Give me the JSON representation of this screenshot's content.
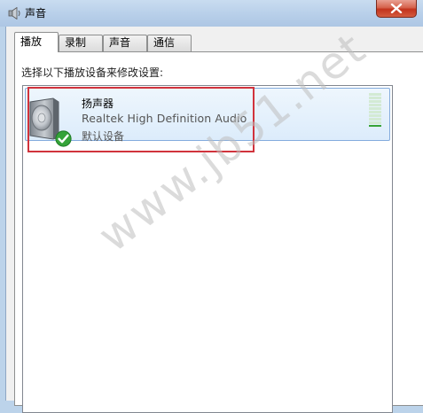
{
  "window": {
    "title": "声音",
    "close_label": "×"
  },
  "tabs": [
    {
      "label": "播放",
      "active": true
    },
    {
      "label": "录制",
      "active": false
    },
    {
      "label": "声音",
      "active": false
    },
    {
      "label": "通信",
      "active": false
    }
  ],
  "playback": {
    "instruction": "选择以下播放设备来修改设置:",
    "devices": [
      {
        "name": "扬声器",
        "description": "Realtek High Definition Audio",
        "status": "默认设备",
        "icon": "speaker-icon",
        "default_badge": "green-check-icon",
        "meter_level": 0.0
      }
    ]
  },
  "watermark": "www.jb51.net",
  "colors": {
    "selection_bg": "#dcecfb",
    "selection_border": "#84acdd",
    "annotation_red": "#d1333c",
    "close_red": "#c2331d",
    "check_green": "#35a339"
  }
}
